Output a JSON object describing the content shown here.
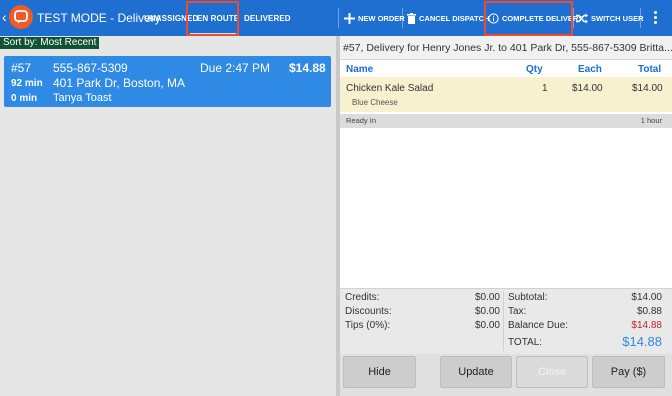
{
  "header": {
    "app_title": "TEST MODE - Delivery",
    "tabs": [
      {
        "label": "UNASSIGNED"
      },
      {
        "label": "EN ROUTE"
      },
      {
        "label": "DELIVERED"
      }
    ],
    "active_tab": "EN ROUTE",
    "actions": {
      "new_order": "NEW ORDER",
      "cancel_dispatch": "CANCEL DISPATCH",
      "complete_delivery": "COMPLETE DELIVERY",
      "switch_user": "SWITCH USER"
    }
  },
  "colors": {
    "topbar": "#1e6fd0",
    "logo": "#f05a25",
    "highlight": "#f04a2a",
    "card": "#2f8ae5",
    "sort_bar": "#0f5236",
    "balance_due": "#c0232c"
  },
  "left": {
    "sort_label": "Sort by: Most Recent",
    "order": {
      "number": "#57",
      "phone": "555-867-5309",
      "due_label": "Due",
      "due_time": "2:47 PM",
      "total": "$14.88",
      "elapsed": "92 min",
      "address": "401 Park Dr, Boston, MA",
      "driver_time": "0 min",
      "driver": "Tanya Toast"
    }
  },
  "detail": {
    "header": "#57, Delivery for Henry Jones Jr. to 401 Park Dr, 555-867-5309 Britta...",
    "columns": {
      "name": "Name",
      "qty": "Qty",
      "each": "Each",
      "total": "Total"
    },
    "items": [
      {
        "name": "Chicken Kale Salad",
        "modifier": "Blue Cheese",
        "qty": "1",
        "each": "$14.00",
        "total": "$14.00"
      }
    ],
    "ready_label": "Ready In",
    "ready_value": "1 hour",
    "totals": {
      "credits_label": "Credits:",
      "credits": "$0.00",
      "discounts_label": "Discounts:",
      "discounts": "$0.00",
      "tips_label": "Tips (0%):",
      "tips": "$0.00",
      "subtotal_label": "Subtotal:",
      "subtotal": "$14.00",
      "tax_label": "Tax:",
      "tax": "$0.88",
      "balance_label": "Balance Due:",
      "balance": "$14.88",
      "total_label": "TOTAL:",
      "total": "$14.88"
    },
    "buttons": {
      "hide": "Hide",
      "update": "Update",
      "close": "Close",
      "pay": "Pay ($)"
    }
  }
}
